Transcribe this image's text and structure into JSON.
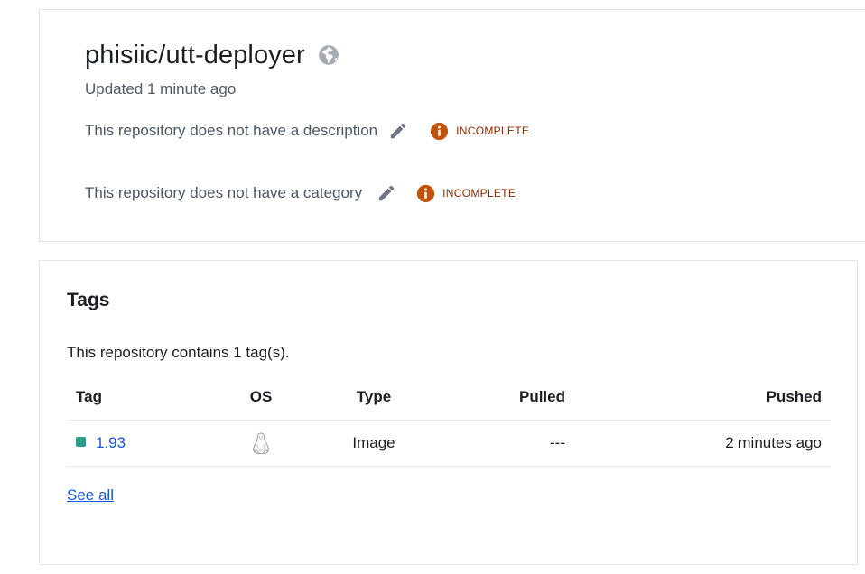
{
  "repo": {
    "name": "phisiic/utt-deployer",
    "visibility_icon": "globe-icon",
    "updated": "Updated 1 minute ago",
    "description_text": "This repository does not have a description",
    "category_text": "This repository does not have a category",
    "edit_icon": "pencil-icon",
    "badge_label": "INCOMPLETE",
    "badge_icon": "info-icon",
    "badge_color": "#c2540a"
  },
  "tags": {
    "title": "Tags",
    "count_text": "This repository contains 1 tag(s).",
    "columns": {
      "tag": "Tag",
      "os": "OS",
      "type": "Type",
      "pulled": "Pulled",
      "pushed": "Pushed"
    },
    "rows": [
      {
        "tag": "1.93",
        "os_icon": "linux-icon",
        "type": "Image",
        "pulled": "---",
        "pushed": "2 minutes ago",
        "status_color": "#2e9c8a"
      }
    ],
    "see_all": "See all"
  }
}
